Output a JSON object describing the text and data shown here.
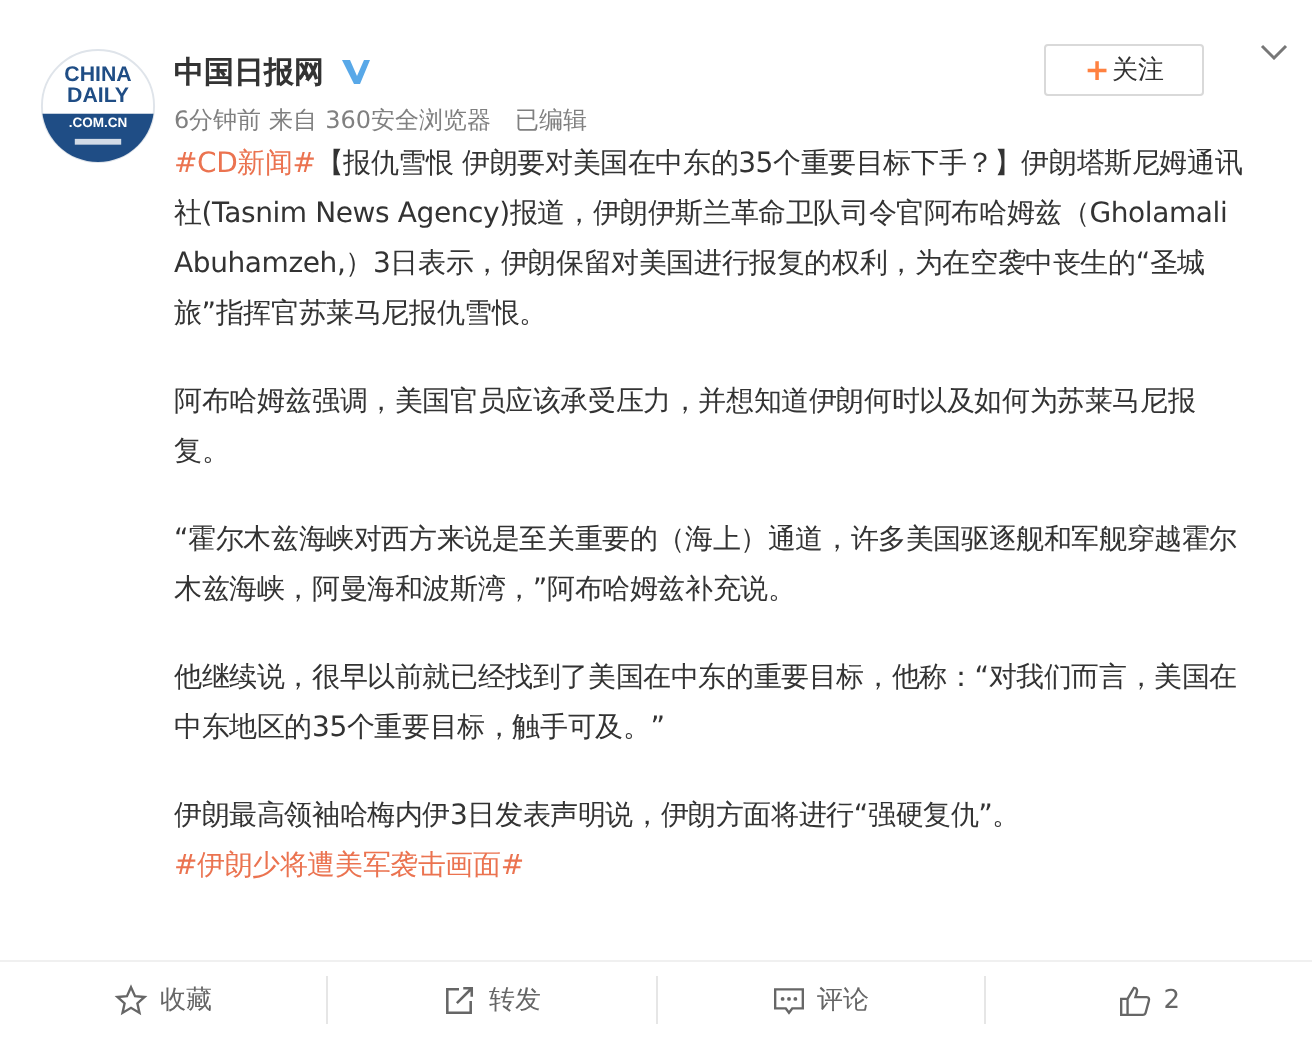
{
  "post": {
    "avatar": {
      "lines": [
        "CHINA",
        "DAILY",
        ".COM.CN"
      ]
    },
    "author": "中国日报网",
    "verified": true,
    "follow_button": {
      "plus": "+",
      "label": "关注"
    },
    "meta": [
      "6分钟前",
      "来自",
      "360安全浏览器",
      "已编辑"
    ],
    "paragraphs": [
      [
        {
          "kind": "topic",
          "text": "#CD新闻#"
        },
        {
          "kind": "text",
          "text": "【报仇雪恨 伊朗要对美国在中东的35个重要目标下手？】伊朗塔斯尼姆通讯社(Tasnim News Agency)报道，伊朗伊斯兰革命卫队司令官阿布哈姆兹（Gholamali Abuhamzeh,）3日表示，伊朗保留对美国进行报复的权利，为在空袭中丧生的“圣城旅”指挥官苏莱马尼报仇雪恨。"
        }
      ],
      [
        {
          "kind": "text",
          "text": "阿布哈姆兹强调，美国官员应该承受压力，并想知道伊朗何时以及如何为苏莱马尼报复。"
        }
      ],
      [
        {
          "kind": "text",
          "text": "“霍尔木兹海峡对西方来说是至关重要的（海上）通道，许多美国驱逐舰和军舰穿越霍尔木兹海峡，阿曼海和波斯湾，”阿布哈姆兹补充说。"
        }
      ],
      [
        {
          "kind": "text",
          "text": "他继续说，很早以前就已经找到了美国在中东的重要目标，他称：“对我们而言，美国在中东地区的35个重要目标，触手可及。”"
        }
      ],
      [
        {
          "kind": "text",
          "text": "伊朗最高领袖哈梅内伊3日发表声明说，伊朗方面将进行“强硬复仇”。"
        },
        {
          "kind": "topic",
          "text": "#伊朗少将遭美军袭击画面#"
        }
      ]
    ]
  },
  "actions": [
    {
      "kind": "star",
      "label": "收藏"
    },
    {
      "kind": "share",
      "label": "转发"
    },
    {
      "kind": "comment",
      "label": "评论"
    },
    {
      "kind": "like",
      "label": "2"
    }
  ]
}
